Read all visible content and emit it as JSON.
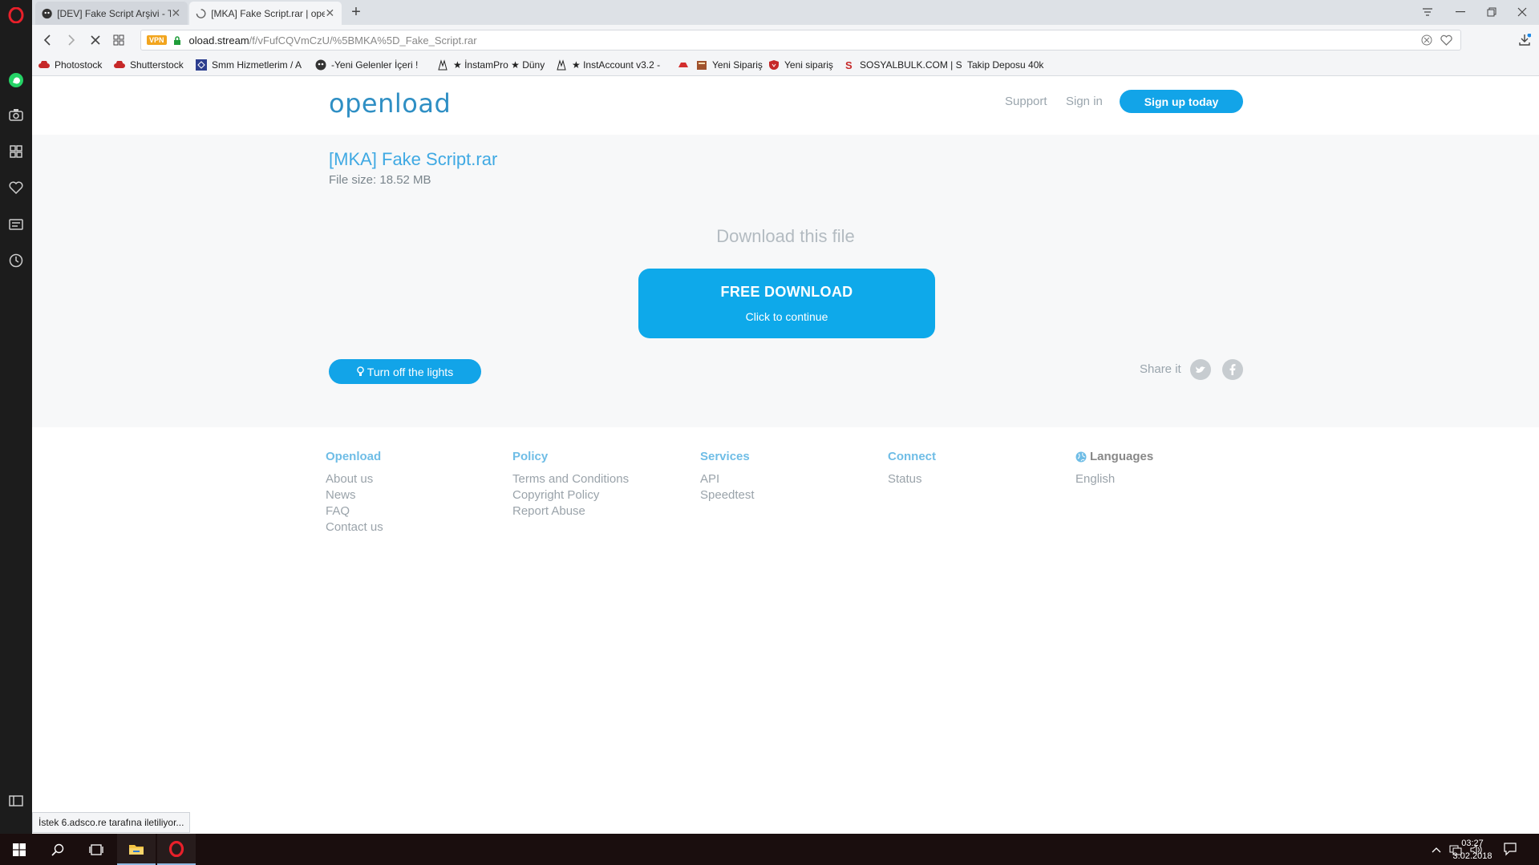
{
  "browser": {
    "tabs": [
      {
        "title": "[DEV] Fake Script Arşivi - T",
        "active": false
      },
      {
        "title": "[MKA] Fake Script.rar | ope",
        "active": true
      }
    ],
    "new_tab_label": "+",
    "address": {
      "vpn_label": "VPN",
      "domain": "oload.stream",
      "path": "/f/vFufCQVmCzU/%5BMKA%5D_Fake_Script.rar"
    },
    "bookmarks": [
      {
        "label": "Photostock",
        "icon": "cloud-red-icon"
      },
      {
        "label": "Shutterstock",
        "icon": "cloud-red-icon"
      },
      {
        "label": "Smm Hizmetlerim / A",
        "icon": "smm-icon"
      },
      {
        "label": "-Yeni Gelenler İçeri !",
        "icon": "ghost-icon"
      },
      {
        "label": "★ İnstamPro ★ Düny",
        "icon": "character-icon"
      },
      {
        "label": "★ InstAccount v3.2 -",
        "icon": "character-icon"
      },
      {
        "label": "",
        "icon": "red-hat-icon"
      },
      {
        "label": "Yeni Sipariş",
        "icon": "box-icon"
      },
      {
        "label": "Yeni sipariş",
        "icon": "shield-red-icon"
      },
      {
        "label": "SOSYALBULK.COM | S",
        "icon": "s-logo-icon"
      },
      {
        "label": "Takip Deposu 40k",
        "icon": "blank-icon"
      }
    ],
    "status_text": "İstek 6.adsco.re tarafına iletiliyor..."
  },
  "site": {
    "logo": "openload",
    "nav": {
      "support": "Support",
      "signin": "Sign in",
      "signup": "Sign up today"
    },
    "file": {
      "title": "[MKA] Fake Script.rar",
      "size": "File size: 18.52 MB"
    },
    "download": {
      "heading": "Download this file",
      "button_main": "FREE DOWNLOAD",
      "button_sub": "Click to continue"
    },
    "lights_button": "Turn off the lights",
    "share_label": "Share it",
    "footer": {
      "columns": [
        {
          "heading": "Openload",
          "links": [
            "About us",
            "News",
            "FAQ",
            "Contact us"
          ]
        },
        {
          "heading": "Policy",
          "links": [
            "Terms and Conditions",
            "Copyright Policy",
            "Report Abuse"
          ]
        },
        {
          "heading": "Services",
          "links": [
            "API",
            "Speedtest"
          ]
        },
        {
          "heading": "Connect",
          "links": [
            "Status"
          ]
        },
        {
          "heading": "Languages",
          "links": [
            "English"
          ]
        }
      ]
    }
  },
  "taskbar": {
    "time": "03:27",
    "date": "3.02.2018"
  },
  "colors": {
    "accent": "#12a4e8",
    "logo": "#2f8fc4",
    "sidebar": "#1c1c1c",
    "taskbar": "#1a0e0e"
  }
}
